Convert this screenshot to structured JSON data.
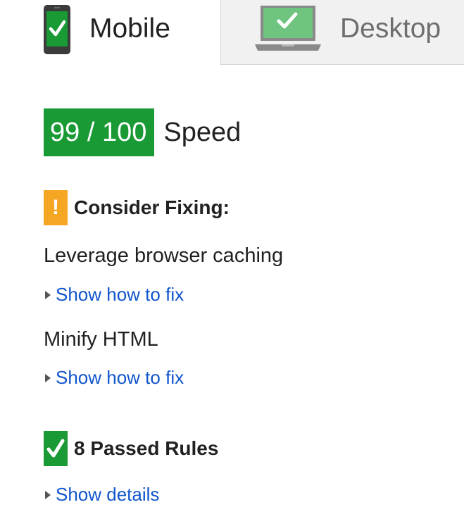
{
  "tabs": {
    "mobile": {
      "label": "Mobile",
      "icon": "phone-check-icon",
      "active": true
    },
    "desktop": {
      "label": "Desktop",
      "icon": "laptop-check-icon",
      "active": false
    }
  },
  "score": {
    "value": "99 / 100",
    "label": "Speed",
    "color": "#199a35"
  },
  "consider_fixing": {
    "badge": "!",
    "title": "Consider Fixing:",
    "color": "#f5a623",
    "rules": [
      {
        "name": "Leverage browser caching",
        "toggle": "Show how to fix"
      },
      {
        "name": "Minify HTML",
        "toggle": "Show how to fix"
      }
    ]
  },
  "passed": {
    "title": "8 Passed Rules",
    "toggle": "Show details",
    "color": "#199a35"
  },
  "colors": {
    "link": "#1155cc",
    "text": "#212121",
    "inactive_tab_bg": "#f1f1f1"
  }
}
